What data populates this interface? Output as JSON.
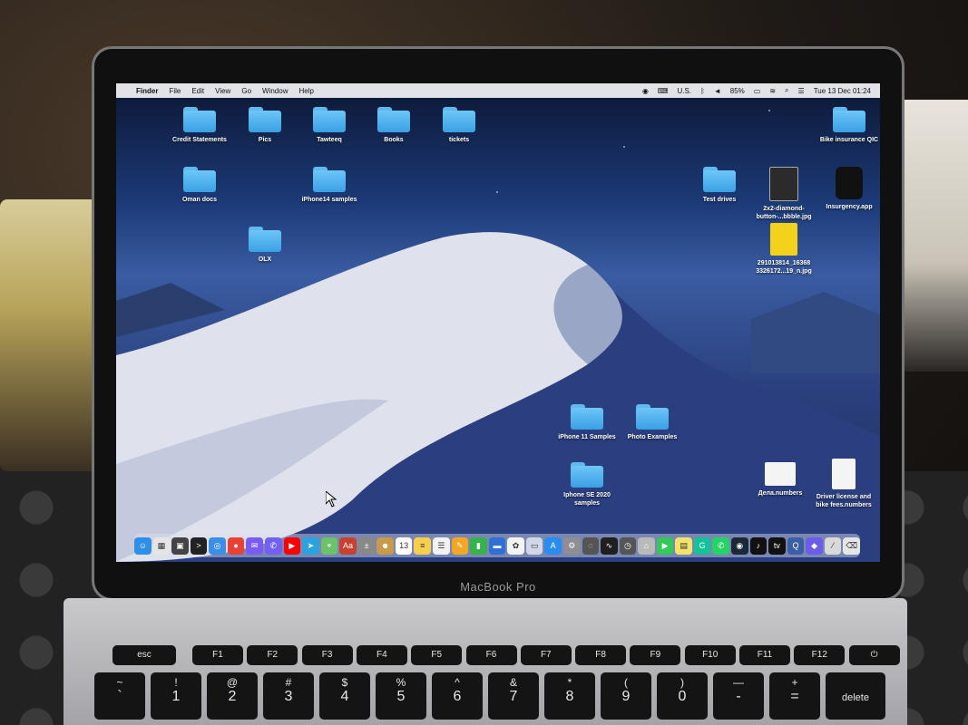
{
  "menubar": {
    "apple": "",
    "app": "Finder",
    "menus": [
      "File",
      "Edit",
      "View",
      "Go",
      "Window",
      "Help"
    ],
    "input_source": "U.S.",
    "battery": "85%",
    "datetime": "Tue 13 Dec  01:24"
  },
  "desktop": {
    "items": [
      {
        "label": "Credit Statements",
        "type": "folder"
      },
      {
        "label": "Pics",
        "type": "folder"
      },
      {
        "label": "Tawteeq",
        "type": "folder"
      },
      {
        "label": "Books",
        "type": "folder"
      },
      {
        "label": "tickets",
        "type": "folder"
      },
      {
        "label": "Bike insurance QIC",
        "type": "folder"
      },
      {
        "label": "Oman docs",
        "type": "folder"
      },
      {
        "label": "iPhone14 samples",
        "type": "folder"
      },
      {
        "label": "Test drives",
        "type": "folder"
      },
      {
        "label": "2x2-diamond-button-...bbble.jpg",
        "type": "image"
      },
      {
        "label": "Insurgency.app",
        "type": "app"
      },
      {
        "label": "OLX",
        "type": "folder"
      },
      {
        "label": "291013814_16368 3326172...19_n.jpg",
        "type": "image"
      },
      {
        "label": "iPhone 11 Samples",
        "type": "folder"
      },
      {
        "label": "Photo Examples",
        "type": "folder"
      },
      {
        "label": "Iphone SE 2020 samples",
        "type": "folder"
      },
      {
        "label": "Дела.numbers",
        "type": "numbers"
      },
      {
        "label": "Driver license and bike fees.numbers",
        "type": "numbers"
      }
    ]
  },
  "dock": {
    "icons": [
      {
        "name": "finder-icon",
        "color": "#2f8ee6",
        "glyph": "☺"
      },
      {
        "name": "launchpad-icon",
        "color": "#e5e5e5",
        "glyph": "▦"
      },
      {
        "name": "mission-control-icon",
        "color": "#444",
        "glyph": "▣"
      },
      {
        "name": "terminal-icon",
        "color": "#222",
        "glyph": ">"
      },
      {
        "name": "safari-icon",
        "color": "#3a8ee8",
        "glyph": "◎"
      },
      {
        "name": "chrome-icon",
        "color": "#e94235",
        "glyph": "●"
      },
      {
        "name": "messenger-icon",
        "color": "#7a5cf5",
        "glyph": "✉"
      },
      {
        "name": "viber-icon",
        "color": "#7360f2",
        "glyph": "✆"
      },
      {
        "name": "youtube-icon",
        "color": "#ff0000",
        "glyph": "▶"
      },
      {
        "name": "telegram-icon",
        "color": "#2aa3de",
        "glyph": "➤"
      },
      {
        "name": "maps-icon",
        "color": "#6cc26b",
        "glyph": "⌖"
      },
      {
        "name": "dictionary-icon",
        "color": "#c8402f",
        "glyph": "Aa"
      },
      {
        "name": "calculator-icon",
        "color": "#888",
        "glyph": "±"
      },
      {
        "name": "contacts-icon",
        "color": "#c89b4a",
        "glyph": "☻"
      },
      {
        "name": "calendar-icon",
        "color": "#ffffff",
        "glyph": "13"
      },
      {
        "name": "notes-icon",
        "color": "#f6d04d",
        "glyph": "≡"
      },
      {
        "name": "reminders-icon",
        "color": "#f2f2f2",
        "glyph": "☰"
      },
      {
        "name": "pages-icon",
        "color": "#f5a623",
        "glyph": "✎"
      },
      {
        "name": "numbers-icon",
        "color": "#36b24a",
        "glyph": "▮"
      },
      {
        "name": "keynote-icon",
        "color": "#2f6fd6",
        "glyph": "▬"
      },
      {
        "name": "photos-icon",
        "color": "#f3f3f3",
        "glyph": "✿"
      },
      {
        "name": "preview-icon",
        "color": "#d0d7e6",
        "glyph": "▭"
      },
      {
        "name": "app-store-icon",
        "color": "#2a8cf0",
        "glyph": "A"
      },
      {
        "name": "settings-icon",
        "color": "#8e8e93",
        "glyph": "⚙"
      },
      {
        "name": "screenshot-icon",
        "color": "#555",
        "glyph": "◌"
      },
      {
        "name": "activity-monitor-icon",
        "color": "#1f1f1f",
        "glyph": "∿"
      },
      {
        "name": "time-machine-icon",
        "color": "#555",
        "glyph": "◷"
      },
      {
        "name": "keychain-icon",
        "color": "#b9b9b9",
        "glyph": "⌂"
      },
      {
        "name": "facetime-icon",
        "color": "#34c759",
        "glyph": "▶"
      },
      {
        "name": "stickies-icon",
        "color": "#f5e26a",
        "glyph": "▤"
      },
      {
        "name": "grammarly-icon",
        "color": "#15c39a",
        "glyph": "G"
      },
      {
        "name": "whatsapp-icon",
        "color": "#25d366",
        "glyph": "✆"
      },
      {
        "name": "steam-icon",
        "color": "#1b2838",
        "glyph": "◉"
      },
      {
        "name": "tiktok-icon",
        "color": "#111",
        "glyph": "♪"
      },
      {
        "name": "apple-tv-icon",
        "color": "#111",
        "glyph": "tv"
      },
      {
        "name": "quicktime-icon",
        "color": "#3b5fa5",
        "glyph": "Q"
      },
      {
        "name": "downloads-stack-icon",
        "color": "#6c5ce7",
        "glyph": "◆"
      },
      {
        "name": "documents-icon",
        "color": "#d9d9d9",
        "glyph": "⁄"
      },
      {
        "name": "trash-icon",
        "color": "#e6e6e6",
        "glyph": "⌫"
      }
    ]
  },
  "laptop": {
    "brand": "MacBook Pro"
  },
  "keyboard": {
    "fn_keys": [
      "esc",
      "F1",
      "F2",
      "F3",
      "F4",
      "F5",
      "F6",
      "F7",
      "F8",
      "F9",
      "F10",
      "F11",
      "F12",
      "⏻"
    ],
    "number_keys": [
      {
        "top": "~",
        "bottom": "`"
      },
      {
        "top": "!",
        "bottom": "1"
      },
      {
        "top": "@",
        "bottom": "2"
      },
      {
        "top": "#",
        "bottom": "3"
      },
      {
        "top": "$",
        "bottom": "4"
      },
      {
        "top": "%",
        "bottom": "5"
      },
      {
        "top": "^",
        "bottom": "6"
      },
      {
        "top": "&",
        "bottom": "7"
      },
      {
        "top": "*",
        "bottom": "8"
      },
      {
        "top": "(",
        "bottom": "9"
      },
      {
        "top": ")",
        "bottom": "0"
      },
      {
        "top": "—",
        "bottom": "-"
      },
      {
        "top": "+",
        "bottom": "="
      },
      {
        "top": "",
        "bottom": "delete"
      }
    ]
  }
}
